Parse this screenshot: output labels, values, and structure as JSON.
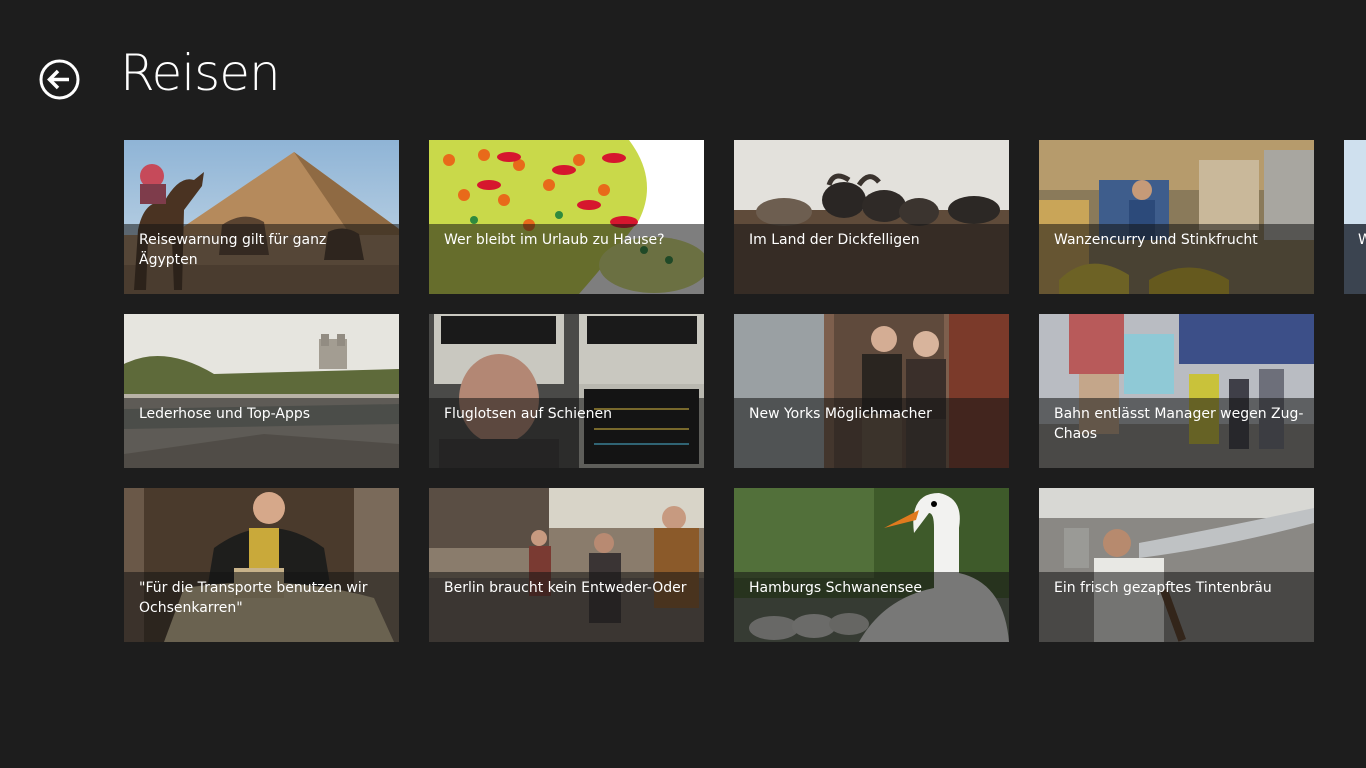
{
  "header": {
    "title": "Reisen",
    "back_icon": "back-arrow-icon"
  },
  "articles": [
    {
      "title": "Reisewarnung gilt für ganz Ägypten",
      "image": "pyramid-camels"
    },
    {
      "title": "Wer bleibt im Urlaub zu Hause?",
      "image": "map-umbrellas-illustration"
    },
    {
      "title": "Im Land der Dickfelligen",
      "image": "sheep-herd"
    },
    {
      "title": "Wanzencurry und Stinkfrucht",
      "image": "market-stall"
    },
    {
      "title": "Lederhose und Top-Apps",
      "image": "river-bank-church"
    },
    {
      "title": "Fluglotsen auf Schienen",
      "image": "train-control-monitors"
    },
    {
      "title": "New Yorks Möglichmacher",
      "image": "two-men-street"
    },
    {
      "title": "Bahn entlässt Manager wegen Zug-Chaos",
      "image": "train-platform-crowd"
    },
    {
      "title": "\"Für die Transporte benutzen wir Ochsenkarren\"",
      "image": "man-with-model"
    },
    {
      "title": "Berlin braucht kein Entweder-Oder",
      "image": "city-street-crowd"
    },
    {
      "title": "Hamburgs Schwanensee",
      "image": "swan-cygnets"
    },
    {
      "title": "Ein frisch gezapftes Tintenbräu",
      "image": "man-with-tap"
    }
  ],
  "peek_tile": {
    "title": "W",
    "image": "partial-tile"
  }
}
